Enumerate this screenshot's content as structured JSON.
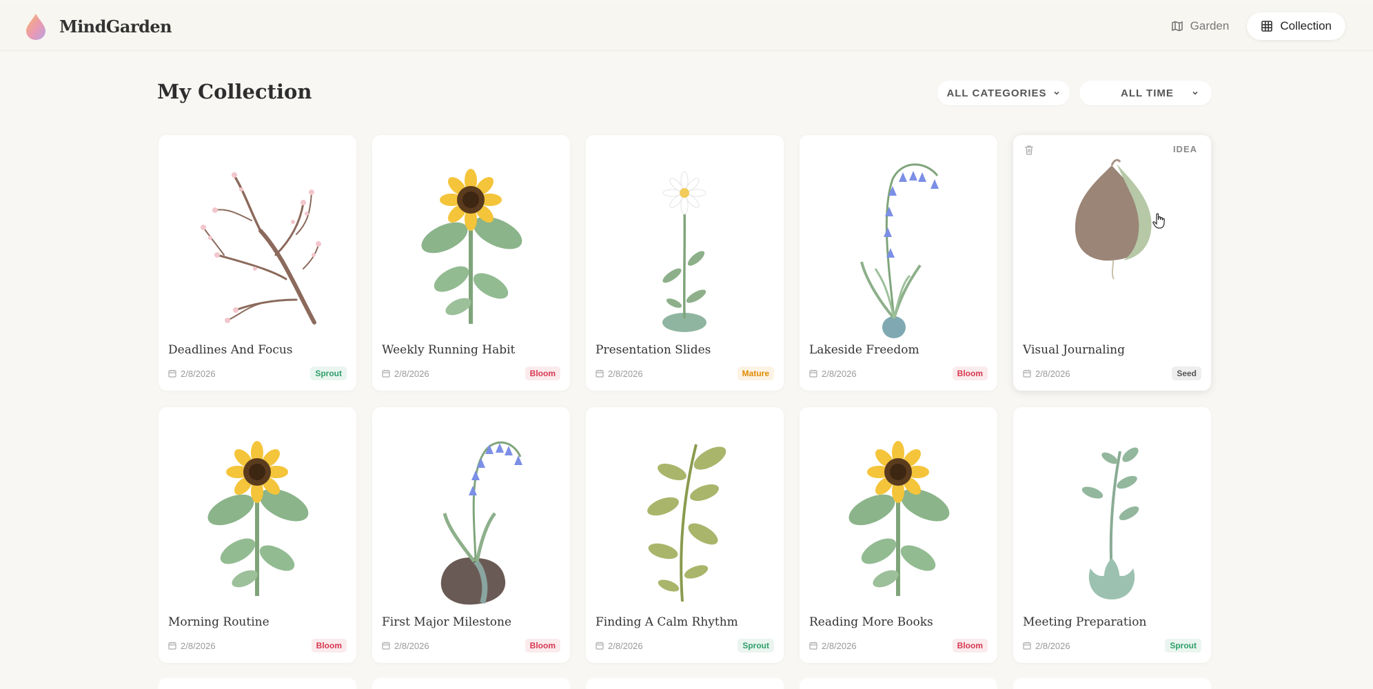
{
  "app": {
    "brand": "MindGarden"
  },
  "nav": {
    "garden_label": "Garden",
    "collection_label": "Collection"
  },
  "page": {
    "title": "My Collection"
  },
  "filters": {
    "category": "ALL CATEGORIES",
    "time": "ALL TIME"
  },
  "colors": {
    "Sprout": "#2e9e6a",
    "Bloom": "#d6364f",
    "Mature": "#e08a00",
    "Seed": "#555555"
  },
  "cards": [
    {
      "title": "Deadlines And Focus",
      "date": "2/8/2026",
      "stage": "Sprout",
      "plant": "branch-icon"
    },
    {
      "title": "Weekly Running Habit",
      "date": "2/8/2026",
      "stage": "Bloom",
      "plant": "sunflower-icon"
    },
    {
      "title": "Presentation Slides",
      "date": "2/8/2026",
      "stage": "Mature",
      "plant": "daisy-icon"
    },
    {
      "title": "Lakeside Freedom",
      "date": "2/8/2026",
      "stage": "Bloom",
      "plant": "bluebell-icon"
    },
    {
      "title": "Visual Journaling",
      "date": "2/8/2026",
      "stage": "Seed",
      "plant": "bulb-icon",
      "type": "IDEA"
    },
    {
      "title": "Morning Routine",
      "date": "2/8/2026",
      "stage": "Bloom",
      "plant": "sunflower-icon"
    },
    {
      "title": "First Major Milestone",
      "date": "2/8/2026",
      "stage": "Bloom",
      "plant": "bluebell-bulb-icon"
    },
    {
      "title": "Finding A Calm Rhythm",
      "date": "2/8/2026",
      "stage": "Sprout",
      "plant": "leafy-stem-icon"
    },
    {
      "title": "Reading More Books",
      "date": "2/8/2026",
      "stage": "Bloom",
      "plant": "sunflower-icon"
    },
    {
      "title": "Meeting Preparation",
      "date": "2/8/2026",
      "stage": "Sprout",
      "plant": "succulent-sprout-icon"
    }
  ]
}
